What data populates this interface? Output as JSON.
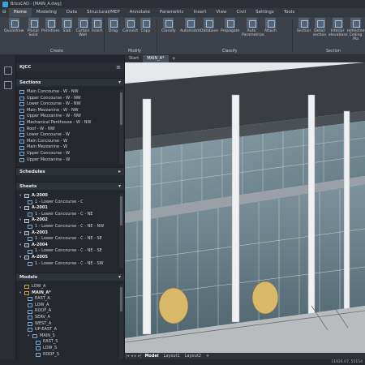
{
  "window": {
    "title": "BricsCAD - [MAIN_A.dwg]"
  },
  "ribbon_tabs": [
    "Home",
    "Modeling",
    "Data",
    "Structural/MEP",
    "Annotate",
    "Parametric",
    "Insert",
    "View",
    "Civil",
    "Settings",
    "Tools"
  ],
  "active_tab": "Home",
  "ribbon": {
    "tools": [
      {
        "label": "Quickdraw"
      },
      {
        "label": "Planar Solid"
      },
      {
        "label": "Primitives"
      },
      {
        "label": "Slab"
      },
      {
        "label": "Curtain Wall"
      },
      {
        "label": "Insert"
      },
      {
        "label": "Drag"
      },
      {
        "label": "Connect"
      },
      {
        "label": "Copy"
      },
      {
        "label": "Classify"
      },
      {
        "label": "Automatch"
      },
      {
        "label": "Database"
      },
      {
        "label": "Propagate"
      },
      {
        "label": "Auto Parametrize"
      },
      {
        "label": "Attach"
      },
      {
        "label": "Section"
      },
      {
        "label": "Detail section"
      },
      {
        "label": "Interior elevations"
      },
      {
        "label": "Reflected Ceiling Pla"
      }
    ],
    "groups": [
      "Create",
      "Modify",
      "Classify",
      "Section"
    ]
  },
  "doc_tabs": [
    "Start",
    "MAIN_A*"
  ],
  "active_doc": "MAIN_A*",
  "panel": {
    "title": "KJCC",
    "sections_title": "Sections",
    "sections": [
      "Main Concourse - W - NW",
      "Upper Concourse - W - NW",
      "Lower Concourse - W - NW",
      "Main Mezzanine - W - NW",
      "Upper Mezzanine - W - NW",
      "Mechanical Penthouse - W - NW",
      "Roof - W - NW",
      "Lower Concourse - W",
      "Main Concourse - W",
      "Main Mezzanine - W",
      "Upper Concourse - W",
      "Upper Mezzanine - W"
    ],
    "schedules_title": "Schedules",
    "sheets_title": "Sheets",
    "sheets": [
      {
        "name": "A-2000",
        "view": "1 - Lower Concourse - C"
      },
      {
        "name": "A-2001",
        "view": "1 - Lower Concourse - C - NE"
      },
      {
        "name": "A-2002",
        "view": "1 - Lower Concourse - C - NE - NW"
      },
      {
        "name": "A-2003",
        "view": "1 - Lower Concourse - C - NE - SE"
      },
      {
        "name": "A-2004",
        "view": "1 - Lower Concourse - C - NE - SE"
      },
      {
        "name": "A-2005",
        "view": "1 - Lower Concourse - C - NE - SW"
      }
    ],
    "models_title": "Models",
    "models": [
      {
        "label": "LOW_A",
        "level": 0
      },
      {
        "label": "MAIN_A*",
        "level": 0
      },
      {
        "label": "EAST_A",
        "level": 1
      },
      {
        "label": "LOW_A",
        "level": 1
      },
      {
        "label": "ROOF_A",
        "level": 1
      },
      {
        "label": "SERV_A",
        "level": 1
      },
      {
        "label": "WEST_A",
        "level": 1
      },
      {
        "label": "UP-EAST_A",
        "level": 1
      },
      {
        "label": "MAIN_S",
        "level": 1
      },
      {
        "label": "EAST_S",
        "level": 2
      },
      {
        "label": "LOW_S",
        "level": 2
      },
      {
        "label": "ROOF_S",
        "level": 2
      }
    ]
  },
  "layout_tabs": [
    "Model",
    "Layout1",
    "Layout2"
  ],
  "active_layout": "Model",
  "status": {
    "coords": "11926.07, 55154"
  },
  "colors": {
    "accent": "#3aa0d8",
    "ribbon_bg": "#3d424a",
    "panel_bg": "#24282e"
  }
}
